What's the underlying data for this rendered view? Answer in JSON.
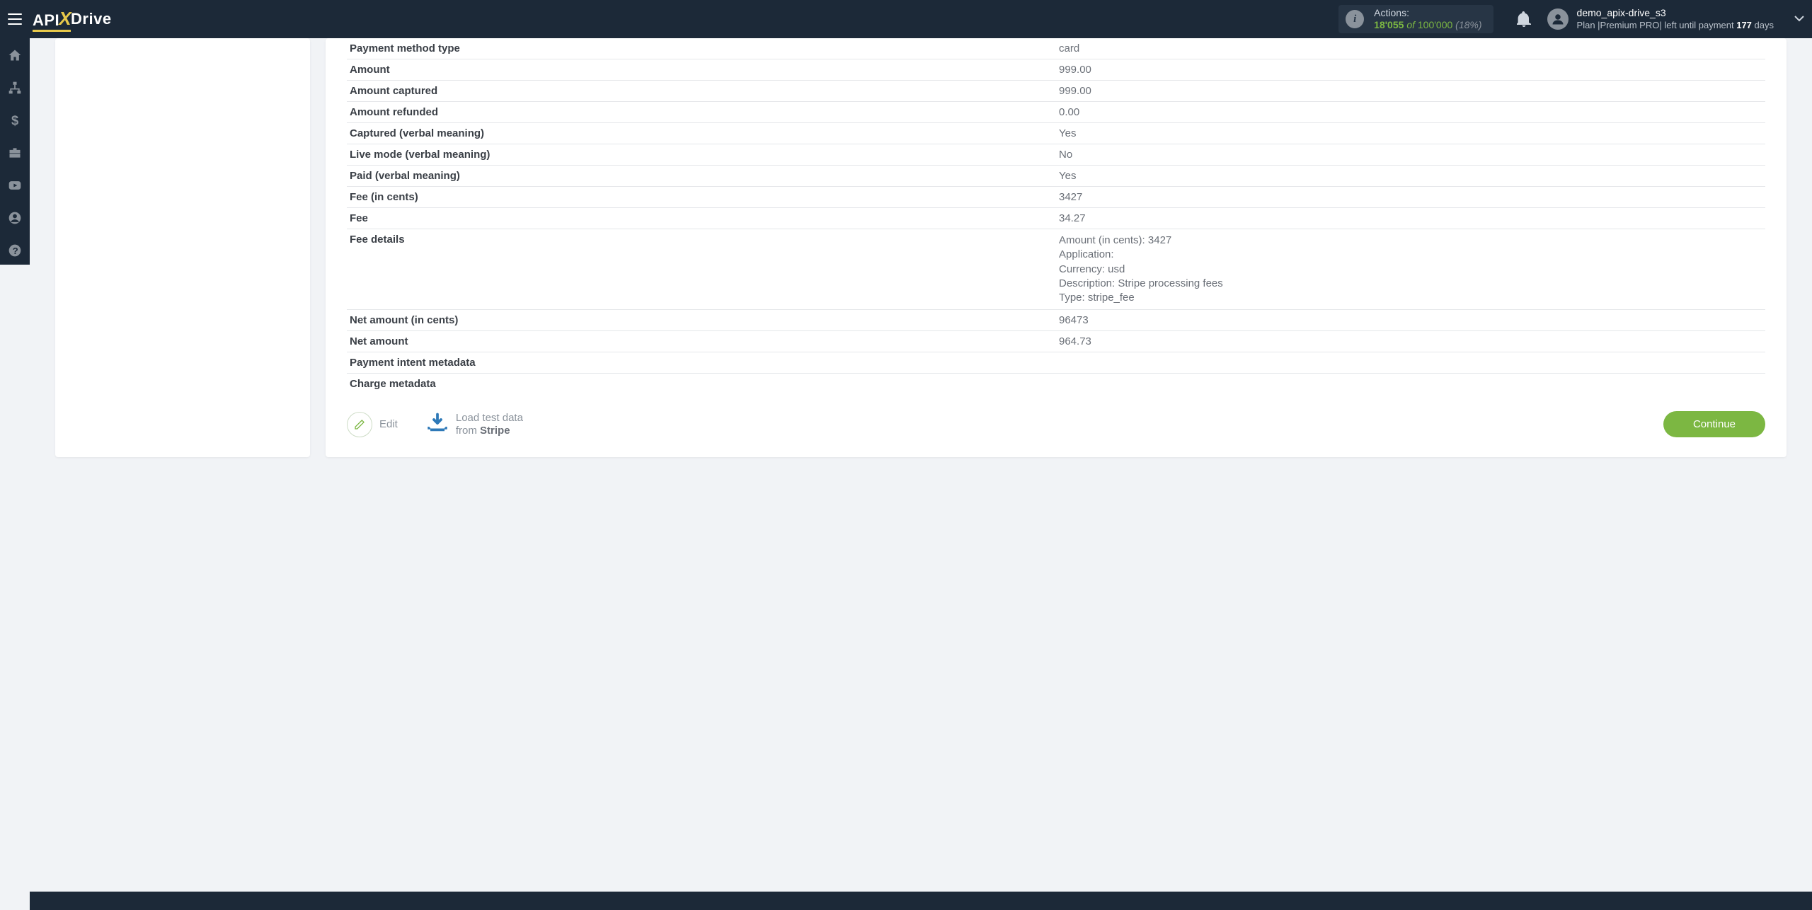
{
  "header": {
    "actions": {
      "label": "Actions:",
      "count": "18'055",
      "of": "of",
      "total": "100'000",
      "percent": "(18%)"
    },
    "user": {
      "name": "demo_apix-drive_s3",
      "plan_prefix": "Plan |",
      "plan_name": "Premium PRO",
      "plan_mid": "| left until payment ",
      "days_value": "177",
      "days_suffix": " days"
    }
  },
  "details": [
    {
      "label": "Payment method type",
      "value": "card"
    },
    {
      "label": "Amount",
      "value": "999.00"
    },
    {
      "label": "Amount captured",
      "value": "999.00"
    },
    {
      "label": "Amount refunded",
      "value": "0.00"
    },
    {
      "label": "Captured (verbal meaning)",
      "value": "Yes"
    },
    {
      "label": "Live mode (verbal meaning)",
      "value": "No"
    },
    {
      "label": "Paid (verbal meaning)",
      "value": "Yes"
    },
    {
      "label": "Fee (in cents)",
      "value": "3427"
    },
    {
      "label": "Fee",
      "value": "34.27"
    },
    {
      "label": "Fee details",
      "value": "Amount (in cents): 3427\nApplication:\nCurrency: usd\nDescription: Stripe processing fees\nType: stripe_fee"
    },
    {
      "label": "Net amount (in cents)",
      "value": "96473"
    },
    {
      "label": "Net amount",
      "value": "964.73"
    },
    {
      "label": "Payment intent metadata",
      "value": ""
    },
    {
      "label": "Charge metadata",
      "value": ""
    }
  ],
  "footer": {
    "edit": "Edit",
    "load_line1": "Load test data",
    "load_from": "from ",
    "load_source": "Stripe",
    "continue": "Continue"
  }
}
